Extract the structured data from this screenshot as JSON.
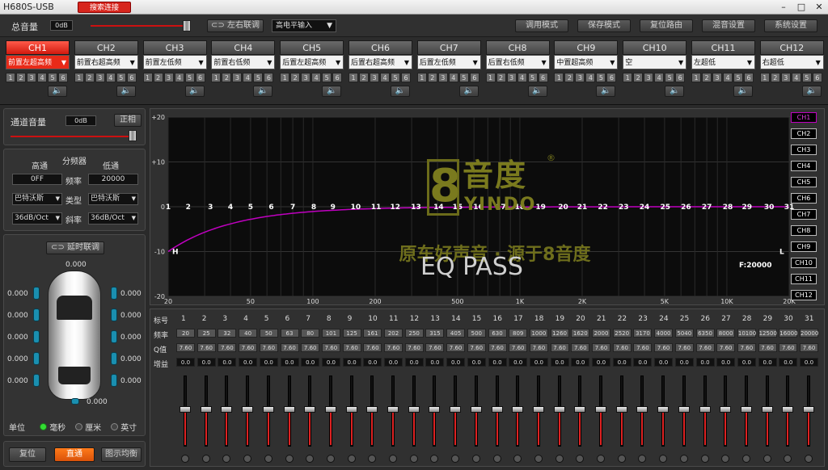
{
  "titlebar": {
    "title": "H680S-USB",
    "search_label": "搜索连接",
    "min": "–",
    "max": "□",
    "close": "✕"
  },
  "topbar": {
    "master_label": "总音量",
    "master_value": "0dB",
    "link_label": "左右联调",
    "input_mode": "高电平输入",
    "buttons": [
      "调用模式",
      "保存模式",
      "复位路由",
      "混音设置",
      "系统设置"
    ]
  },
  "channels": [
    {
      "name": "CH1",
      "assign": "前置左超高频"
    },
    {
      "name": "CH2",
      "assign": "前置右超高频"
    },
    {
      "name": "CH3",
      "assign": "前置左低频"
    },
    {
      "name": "CH4",
      "assign": "前置右低频"
    },
    {
      "name": "CH5",
      "assign": "后置左超高频"
    },
    {
      "name": "CH6",
      "assign": "后置右超高频"
    },
    {
      "name": "CH7",
      "assign": "后置左低频"
    },
    {
      "name": "CH8",
      "assign": "后置右低频"
    },
    {
      "name": "CH9",
      "assign": "中置超高频"
    },
    {
      "name": "CH10",
      "assign": "空"
    },
    {
      "name": "CH11",
      "assign": "左超低"
    },
    {
      "name": "CH12",
      "assign": "右超低"
    }
  ],
  "channel_numbers": [
    "1",
    "2",
    "3",
    "4",
    "5",
    "6"
  ],
  "speaker_glyph": "🔈",
  "left": {
    "channel_volume_label": "通道音量",
    "channel_volume_value": "0dB",
    "phase_label": "正相",
    "highpass": "高通",
    "crossover": "分频器",
    "lowpass": "低通",
    "hp_freq": "0FF",
    "freq_label": "频率",
    "lp_freq": "20000",
    "hp_type": "巴特沃斯",
    "type_label": "类型",
    "lp_type": "巴特沃斯",
    "hp_slope": "36dB/Oct",
    "slope_label": "斜率",
    "lp_slope": "36dB/Oct",
    "delay_link": "延时联调",
    "delay_top": "0.000",
    "delays_left": [
      "0.000",
      "0.000",
      "0.000",
      "0.000",
      "0.000"
    ],
    "delays_right": [
      "0.000",
      "0.000",
      "0.000",
      "0.000",
      "0.000"
    ],
    "delay_bottom": "0.000",
    "unit_label": "单位",
    "unit_ms": "毫秒",
    "unit_cm": "厘米",
    "unit_inch": "英寸",
    "reset": "复位",
    "bypass": "直通",
    "graphic_eq": "图示均衡"
  },
  "graph": {
    "y_ticks": [
      "+20",
      "+10",
      "0",
      "-10",
      "-20"
    ],
    "x_ticks": [
      "20",
      "50",
      "100",
      "200",
      "500",
      "1K",
      "2K",
      "5K",
      "10K",
      "20K"
    ],
    "points": [
      "1",
      "2",
      "3",
      "4",
      "5",
      "6",
      "7",
      "8",
      "9",
      "10",
      "11",
      "12",
      "13",
      "14",
      "15",
      "16",
      "17",
      "18",
      "19",
      "20",
      "21",
      "22",
      "23",
      "24",
      "25",
      "26",
      "27",
      "28",
      "29",
      "30",
      "31"
    ],
    "h_label": "H",
    "l_label": "L",
    "freq_readout": "F:20000",
    "watermark_brand": "YINDO",
    "watermark_char": "音度",
    "watermark_num": "8",
    "slogan": "原车好声音 · 源于8音度",
    "eq_pass": "EQ PASS",
    "ch_legend": [
      "CH1",
      "CH2",
      "CH3",
      "CH4",
      "CH5",
      "CH6",
      "CH7",
      "CH8",
      "CH9",
      "CH10",
      "CH11",
      "CH12"
    ]
  },
  "table": {
    "row_labels": [
      "标号",
      "频率",
      "Q值",
      "增益"
    ],
    "freqs": [
      "20",
      "25",
      "32",
      "40",
      "50",
      "63",
      "80",
      "101",
      "125",
      "161",
      "202",
      "250",
      "315",
      "405",
      "500",
      "630",
      "809",
      "1000",
      "1260",
      "1620",
      "2000",
      "2520",
      "3170",
      "4000",
      "5040",
      "6350",
      "8000",
      "10100",
      "12500",
      "16000",
      "20000"
    ],
    "q": "7.60",
    "gain": "0.0"
  },
  "colors": {
    "accent": "#e82a18",
    "curve": "#c000c0",
    "green": "#33dd33"
  }
}
